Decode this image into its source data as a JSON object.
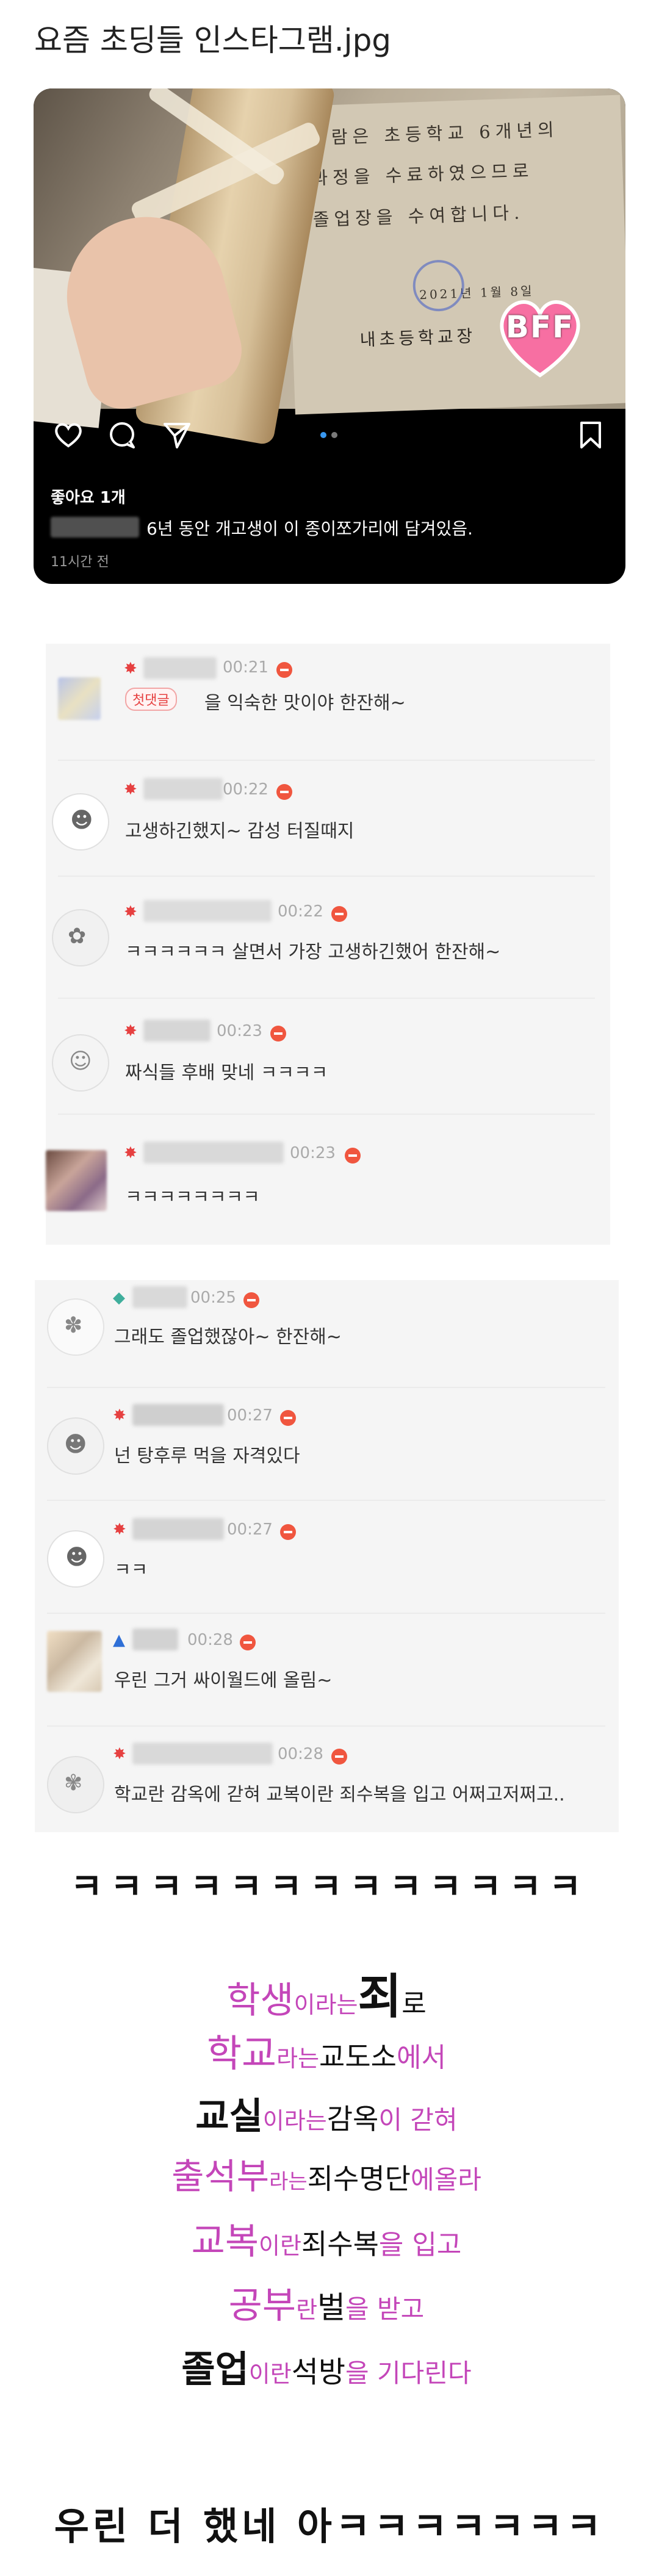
{
  "post": {
    "title": "요즘 초딩들 인스타그램.jpg"
  },
  "insta": {
    "certificate": {
      "line1": "사람은 초등학교 6개년의",
      "line2": "과정을 수료하였으므로",
      "line3": "졸업장을 수여합니다.",
      "date": "2021년 1월 8일",
      "school": "내초등학교장"
    },
    "badge": "BFF",
    "icons": [
      "heart-icon",
      "comment-icon",
      "send-icon",
      "bookmark-icon"
    ],
    "likes": "좋아요 1개",
    "caption": "6년 동안 개고생이 이 종이쪼가리에 담겨있음.",
    "time_ago": "11시간 전"
  },
  "panel1": {
    "comments": [
      {
        "time": "00:21",
        "badge": "첫댓글",
        "text": "을 익숙한 맛이야 한잔해~"
      },
      {
        "time": "00:22",
        "text": "고생하긴했지~ 감성 터질때지"
      },
      {
        "time": "00:22",
        "text": "ㅋㅋㅋㅋㅋㅋ 살면서 가장 고생하긴했어 한잔해~"
      },
      {
        "time": "00:23",
        "text": "짜식들 후배 맞네 ㅋㅋㅋㅋ"
      },
      {
        "time": "00:23",
        "text": "ㅋㅋㅋㅋㅋㅋㅋㅋ"
      }
    ]
  },
  "panel2": {
    "comments": [
      {
        "time": "00:25",
        "text": "그래도 졸업했잖아~ 한잔해~"
      },
      {
        "time": "00:27",
        "text": "넌 탕후루 먹을 자격있다"
      },
      {
        "time": "00:27",
        "text": "ㅋㅋ"
      },
      {
        "time": "00:28",
        "text": "우린 그거 싸이월드에 올림~"
      },
      {
        "time": "00:28",
        "text": "학교란 감옥에 갇혀 교복이란 죄수복을 입고 어쩌고저쩌고.."
      }
    ]
  },
  "laugh1": "ㅋㅋㅋㅋㅋㅋㅋㅋㅋㅋㅋㅋㅋ",
  "poem": {
    "l1a": "학생",
    "l1b": "이라는",
    "l1c": "죄",
    "l1d": "로",
    "l2a": "학교",
    "l2b": "라는",
    "l2c": "교도소",
    "l2d": "에서",
    "l3a": "교실",
    "l3b": "이라는",
    "l3c": "감옥",
    "l3d": "이 갇혀",
    "l4a": "출석부",
    "l4b": "라는",
    "l4c": "죄수명단",
    "l4d": "에올라",
    "l5a": "교복",
    "l5b": "이란",
    "l5c": "죄수복",
    "l5d": "을 입고",
    "l6a": "공부",
    "l6b": "란",
    "l6c": "벌",
    "l6d": "을 받고",
    "l7a": "졸업",
    "l7b": "이란",
    "l7c": "석방",
    "l7d": "을 기다린다"
  },
  "closing": "우린 더 했네 아ㅋㅋㅋㅋㅋㅋㅋ",
  "colors": {
    "pink": "#c446b9",
    "red_badge": "#f0563f",
    "insta_bg": "#000000"
  }
}
